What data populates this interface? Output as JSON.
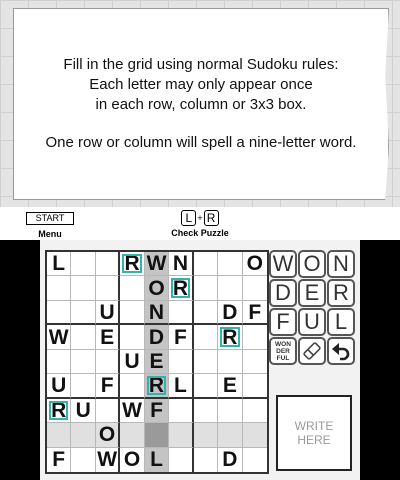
{
  "instructions": {
    "rules_lines": [
      "Fill in the grid using normal Sudoku rules:",
      "Each letter may only appear once",
      "in each row, column or 3x3 box."
    ],
    "word_hint": "One row or column will spell a nine-letter word."
  },
  "controls": {
    "start_key": "START",
    "menu_label": "Menu",
    "l_key": "L",
    "plus": "+",
    "r_key": "R",
    "check_label": "Check Puzzle"
  },
  "grid": {
    "rows": [
      [
        "L",
        "",
        "",
        "R",
        "W",
        "N",
        "",
        "",
        "O"
      ],
      [
        "",
        "",
        "",
        "",
        "O",
        "R",
        "",
        "",
        ""
      ],
      [
        "",
        "",
        "U",
        "",
        "N",
        "",
        "",
        "D",
        "F"
      ],
      [
        "W",
        "",
        "E",
        "",
        "D",
        "F",
        "",
        "R",
        ""
      ],
      [
        "",
        "",
        "",
        "U",
        "E",
        "",
        "",
        "",
        ""
      ],
      [
        "U",
        "",
        "F",
        "",
        "R",
        "L",
        "",
        "E",
        ""
      ],
      [
        "R",
        "U",
        "",
        "W",
        "F",
        "",
        "",
        "",
        ""
      ],
      [
        "",
        "",
        "O",
        "",
        "",
        "",
        "",
        "",
        ""
      ],
      [
        "F",
        "",
        "W",
        "O",
        "L",
        "",
        "",
        "D",
        ""
      ]
    ],
    "given_cells": [
      [
        0,
        3
      ],
      [
        1,
        5
      ],
      [
        3,
        7
      ],
      [
        5,
        4
      ],
      [
        6,
        0
      ]
    ],
    "selected_cell": [
      7,
      4
    ]
  },
  "palette": {
    "rows": [
      [
        "W",
        "O",
        "N"
      ],
      [
        "D",
        "E",
        "R"
      ],
      [
        "F",
        "U",
        "L"
      ]
    ],
    "word_key_lines": [
      "WON",
      "DER",
      "FUL"
    ],
    "tools": [
      "word-view-icon",
      "eraser-icon",
      "undo-icon"
    ]
  },
  "write_area": {
    "lines": [
      "WRITE",
      "HERE"
    ]
  },
  "colors": {
    "given_outline": "#2fb3aa",
    "highlight_row": "#e0e0e0",
    "highlight_column": "#c4c4c4",
    "selected_cell": "#9a9a9a"
  }
}
